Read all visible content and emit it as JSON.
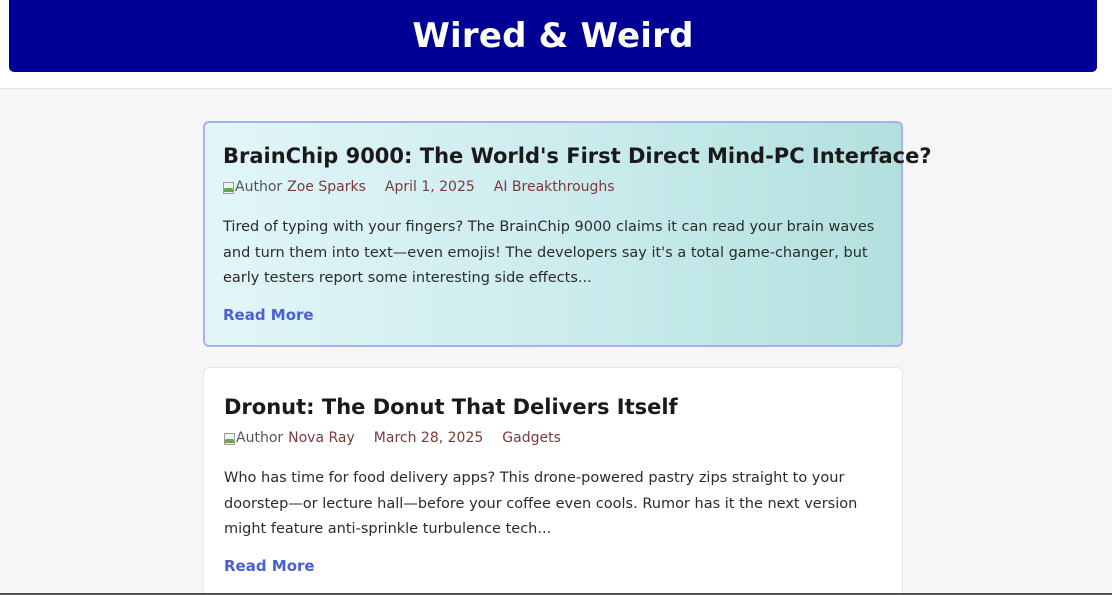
{
  "site": {
    "title": "Wired & Weird"
  },
  "posts": [
    {
      "title": "BrainChip 9000: The World's First Direct Mind-PC Interface?",
      "author_img_alt": "Author",
      "author": "Zoe Sparks",
      "date": "April 1, 2025",
      "category": "AI Breakthroughs",
      "excerpt": "Tired of typing with your fingers? The BrainChip 9000 claims it can read your brain waves and turn them into text—even emojis! The developers say it's a total game-changer, but early testers report some interesting side effects...",
      "read_more": "Read More",
      "featured": true
    },
    {
      "title": "Dronut: The Donut That Delivers Itself",
      "author_img_alt": "Author",
      "author": "Nova Ray",
      "date": "March 28, 2025",
      "category": "Gadgets",
      "excerpt": "Who has time for food delivery apps? This drone-powered pastry zips straight to your doorstep—or lecture hall—before your coffee even cools. Rumor has it the next version might feature anti-sprinkle turbulence tech...",
      "read_more": "Read More",
      "featured": false
    }
  ],
  "colors": {
    "header_bg": "#000094",
    "link": "#4a5fd0",
    "meta_text": "#7a3a3a",
    "featured_border": "#aab0ee"
  }
}
